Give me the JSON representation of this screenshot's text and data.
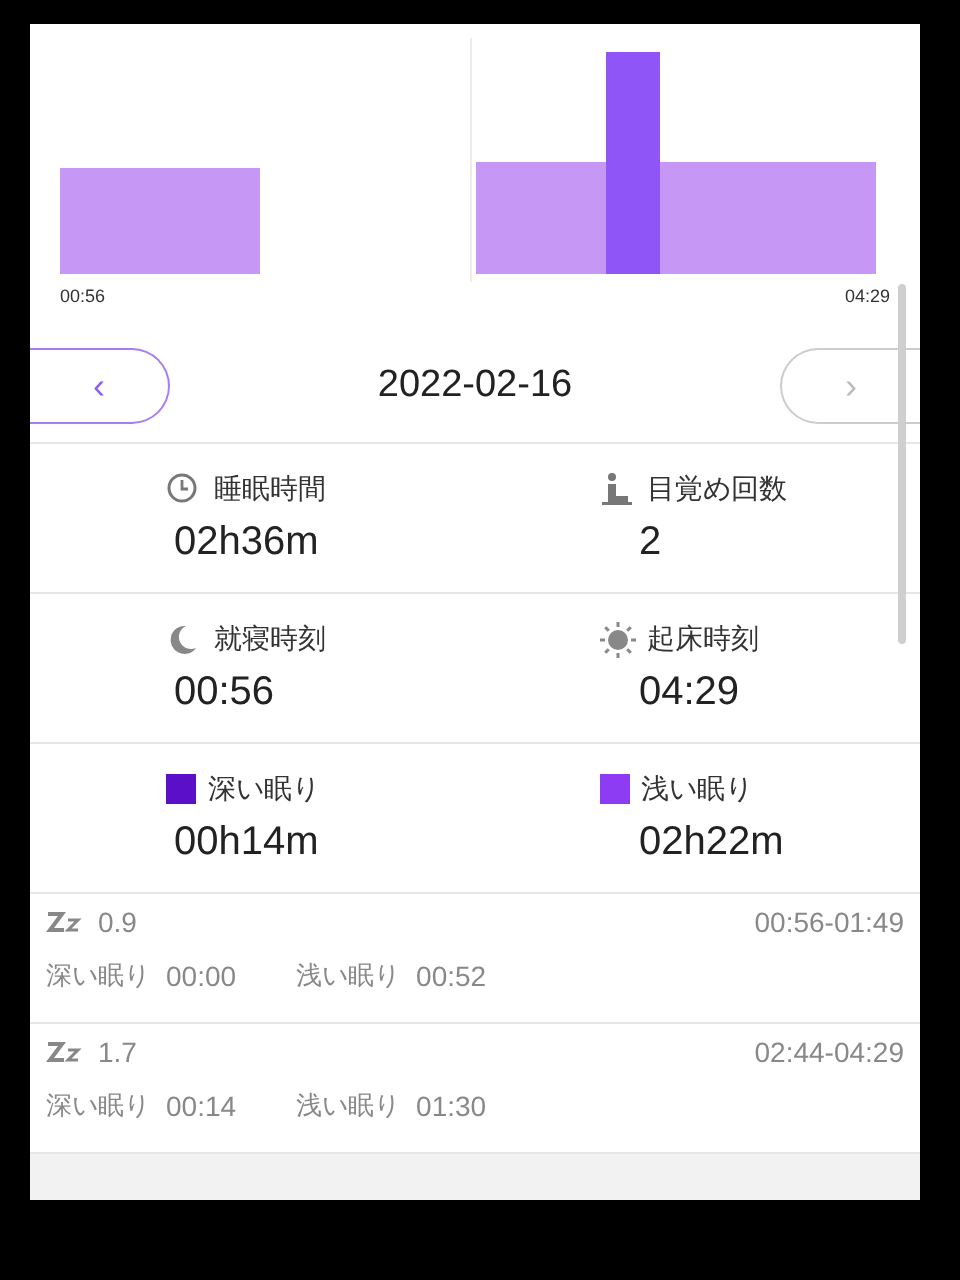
{
  "timeline": {
    "start": "00:56",
    "end": "04:29"
  },
  "nav": {
    "prev": "‹",
    "date": "2022-02-16",
    "next": "›",
    "prev_enabled": true,
    "next_enabled": false
  },
  "stats": [
    {
      "kind": "clock",
      "label": "睡眠時間",
      "value": "02h36m"
    },
    {
      "kind": "person",
      "label": "目覚め回数",
      "value": "2"
    },
    {
      "kind": "moon",
      "label": "就寝時刻",
      "value": "00:56"
    },
    {
      "kind": "sun",
      "label": "起床時刻",
      "value": "04:29"
    },
    {
      "kind": "swatch",
      "label": "深い眠り",
      "value": "00h14m",
      "color": "#5a10c8"
    },
    {
      "kind": "swatch",
      "label": "浅い眠り",
      "value": "02h22m",
      "color": "#8e3cf4"
    }
  ],
  "records": [
    {
      "score": "0.9",
      "range": "00:56-01:49",
      "deep_label": "深い眠り",
      "deep": "00:00",
      "light_label": "浅い眠り",
      "light": "00:52"
    },
    {
      "score": "1.7",
      "range": "02:44-04:29",
      "deep_label": "深い眠り",
      "deep": "00:14",
      "light_label": "浅い眠り",
      "light": "01:30"
    }
  ]
}
